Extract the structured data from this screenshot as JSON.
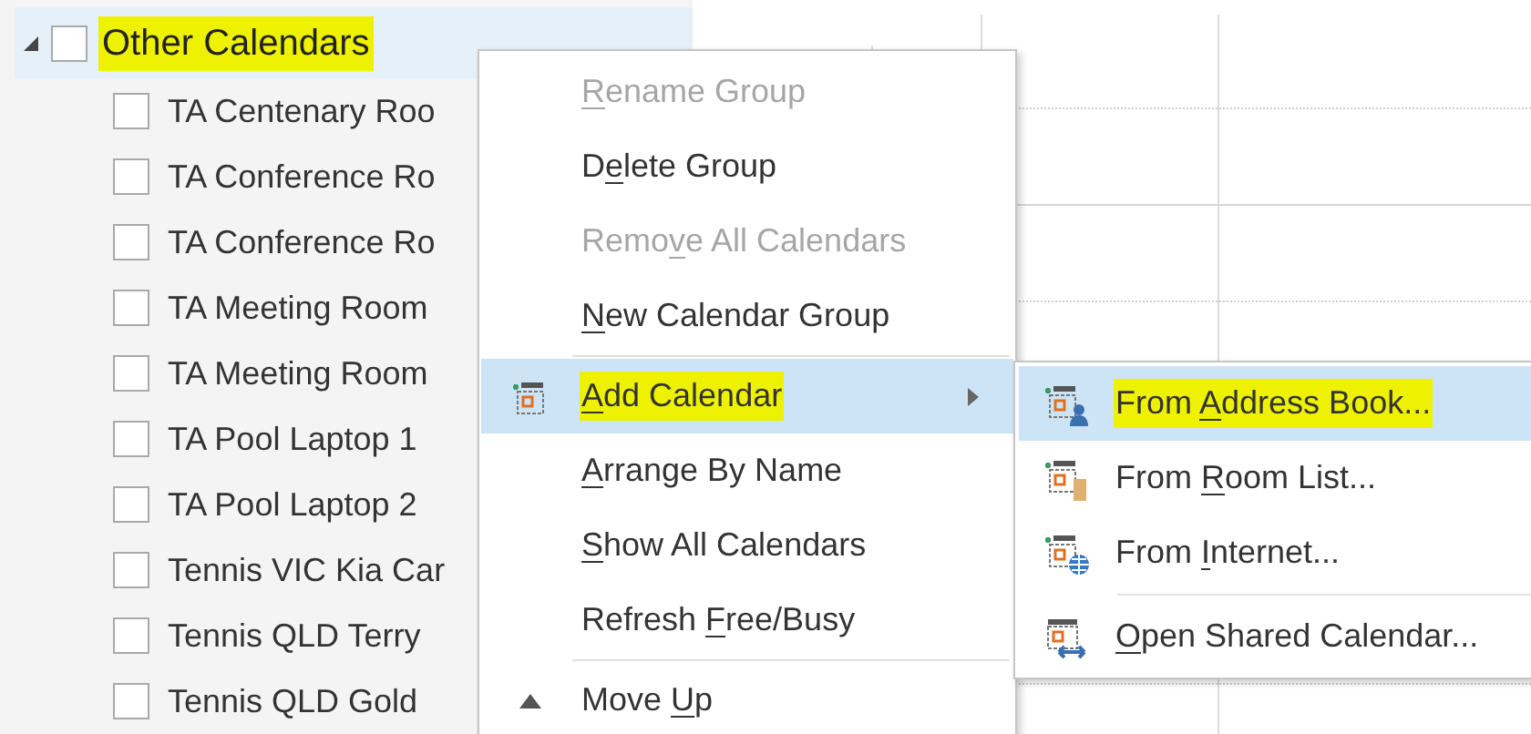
{
  "calendar_group": {
    "label": "Other Calendars",
    "expanded": true,
    "checked": false,
    "highlighted": true,
    "children": [
      {
        "label": "TA Centenary Roo",
        "checked": false
      },
      {
        "label": "TA Conference Ro",
        "checked": false
      },
      {
        "label": "TA Conference Ro",
        "checked": false
      },
      {
        "label": "TA Meeting Room",
        "checked": false
      },
      {
        "label": "TA Meeting Room",
        "checked": false
      },
      {
        "label": "TA Pool Laptop 1",
        "checked": false
      },
      {
        "label": "TA Pool Laptop 2",
        "checked": false
      },
      {
        "label": "Tennis VIC Kia Car",
        "checked": false
      },
      {
        "label": "Tennis QLD Terry",
        "checked": false
      },
      {
        "label": "Tennis QLD Gold",
        "checked": false
      }
    ]
  },
  "context_menu": {
    "items": [
      {
        "kind": "plain",
        "key": "R",
        "post": "ename Group",
        "disabled": true,
        "selected": false,
        "highlighted": false,
        "has_submenu": false
      },
      {
        "kind": "plain",
        "pre": "D",
        "key": "e",
        "post": "lete Group",
        "disabled": false,
        "selected": false,
        "highlighted": false,
        "has_submenu": false
      },
      {
        "kind": "plain",
        "pre": "Remo",
        "key": "v",
        "post": "e All Calendars",
        "disabled": true,
        "selected": false,
        "highlighted": false,
        "has_submenu": false
      },
      {
        "kind": "plain",
        "key": "N",
        "post": "ew Calendar Group",
        "disabled": false,
        "selected": false,
        "highlighted": false,
        "has_submenu": false
      },
      {
        "kind": "separator"
      },
      {
        "kind": "add-calendar",
        "key": "A",
        "post": "dd Calendar",
        "disabled": false,
        "selected": true,
        "highlighted": true,
        "has_submenu": true
      },
      {
        "kind": "plain",
        "key": "A",
        "post": "rrange By Name",
        "disabled": false,
        "selected": false,
        "highlighted": false,
        "has_submenu": false
      },
      {
        "kind": "plain",
        "key": "S",
        "post": "how All Calendars",
        "disabled": false,
        "selected": false,
        "highlighted": false,
        "has_submenu": false
      },
      {
        "kind": "plain",
        "pre": "Refresh ",
        "key": "F",
        "post": "ree/Busy",
        "disabled": false,
        "selected": false,
        "highlighted": false,
        "has_submenu": false
      },
      {
        "kind": "separator"
      },
      {
        "kind": "move-up",
        "pre": "Move ",
        "key": "U",
        "post": "p",
        "disabled": false,
        "selected": false,
        "highlighted": false,
        "has_submenu": false
      }
    ]
  },
  "submenu": {
    "items": [
      {
        "kind": "address-book",
        "pre": "From ",
        "key": "A",
        "post": "ddress Book...",
        "selected": true,
        "highlighted": true
      },
      {
        "kind": "room-list",
        "pre": "From ",
        "key": "R",
        "post": "oom List...",
        "selected": false,
        "highlighted": false
      },
      {
        "kind": "internet",
        "pre": "From ",
        "key": "I",
        "post": "nternet...",
        "selected": false,
        "highlighted": false
      },
      {
        "kind": "separator"
      },
      {
        "kind": "shared",
        "key": "O",
        "post": "pen Shared Calendar...",
        "selected": false,
        "highlighted": false
      }
    ]
  }
}
